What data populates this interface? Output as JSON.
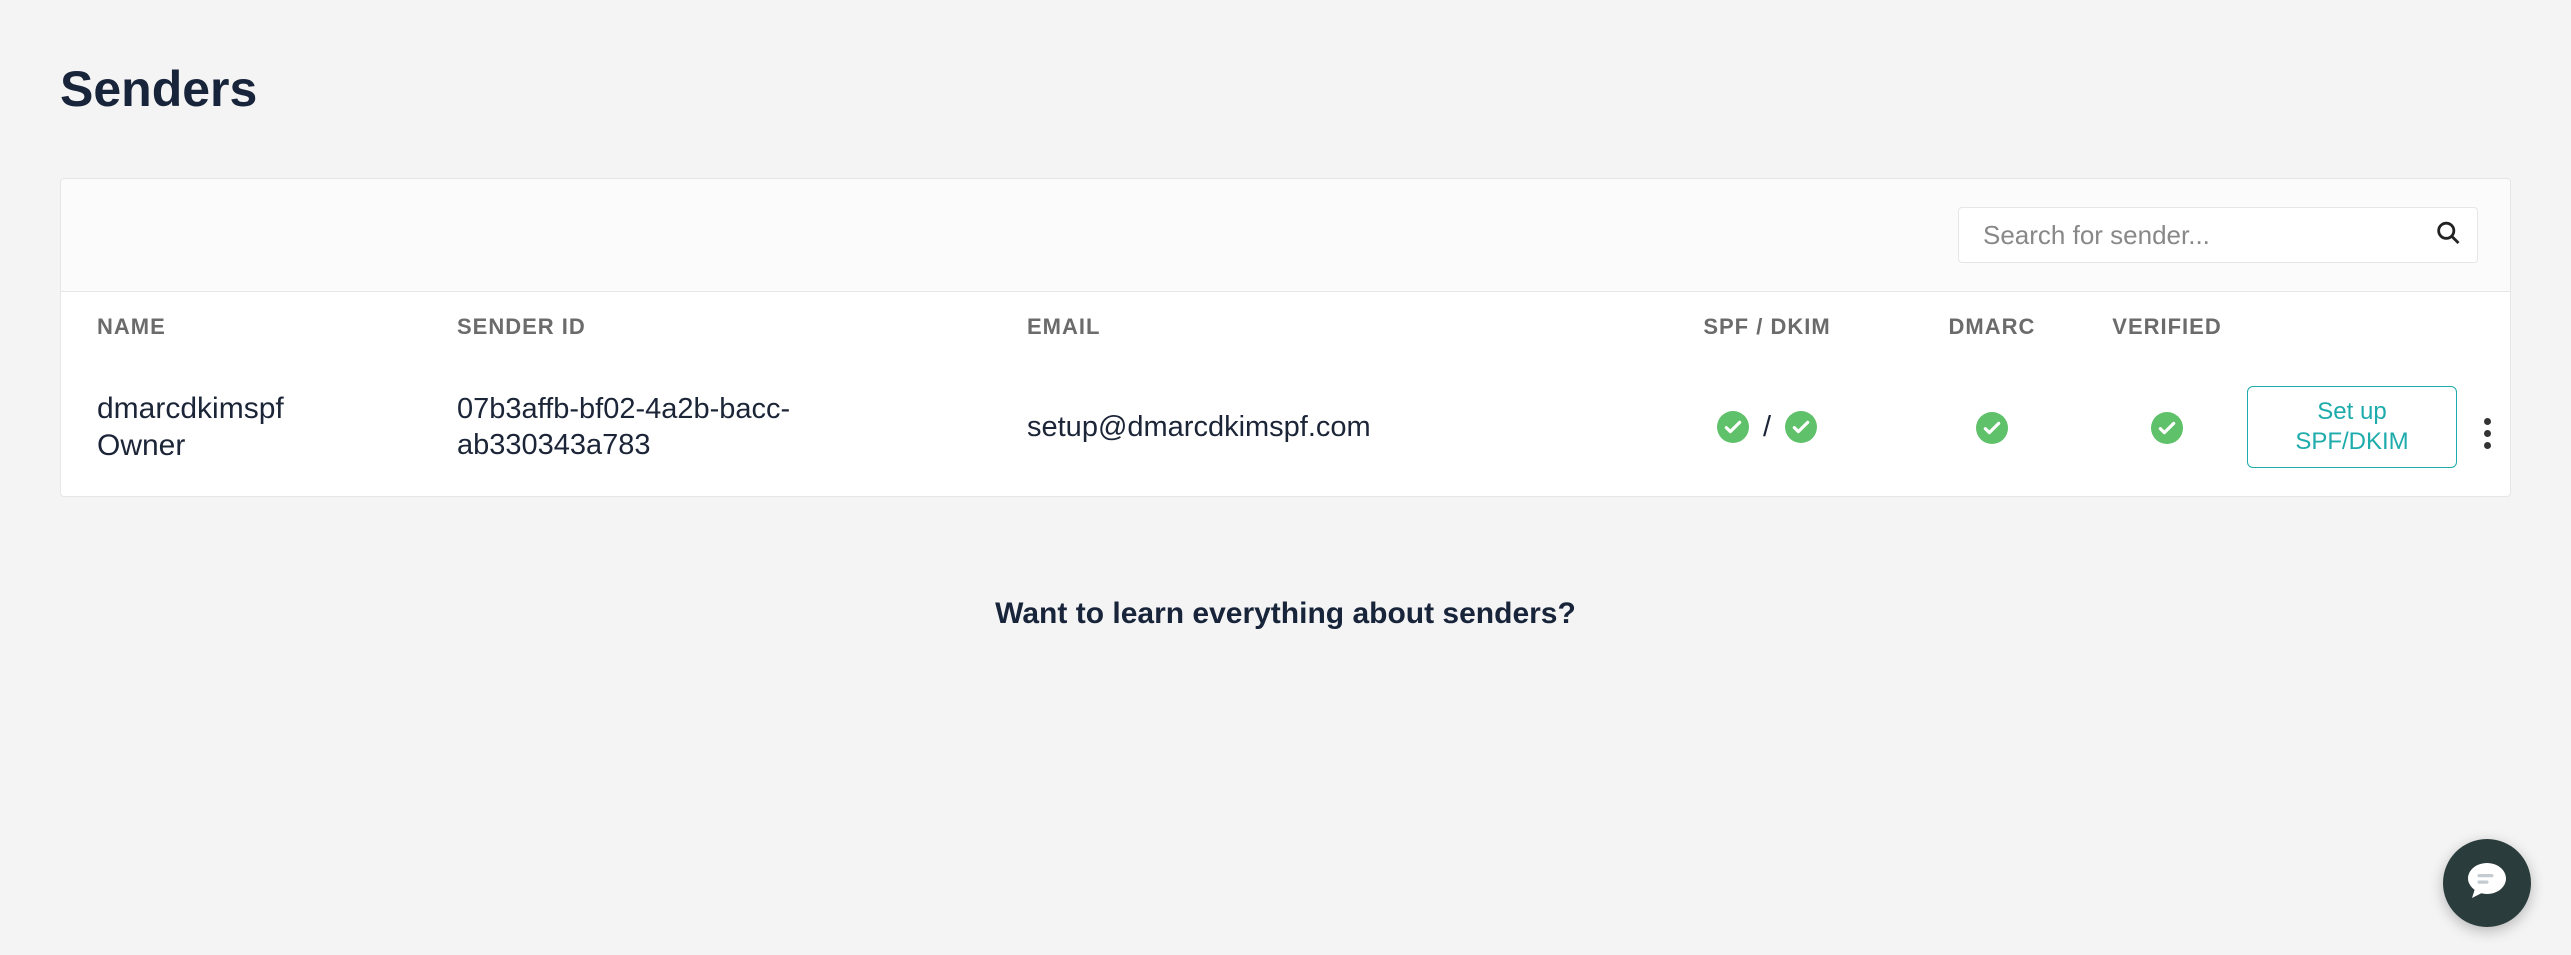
{
  "page": {
    "title": "Senders",
    "learn_cta": "Want to learn everything about senders?"
  },
  "toolbar": {
    "search_placeholder": "Search for sender..."
  },
  "table": {
    "headers": {
      "name": "NAME",
      "sender_id": "SENDER ID",
      "email": "EMAIL",
      "spf_dkim": "SPF / DKIM",
      "dmarc": "DMARC",
      "verified": "VERIFIED"
    },
    "rows": [
      {
        "name_line1": "dmarcdkimspf",
        "name_line2": "Owner",
        "sender_id_line1": "07b3affb-bf02-4a2b-bacc-",
        "sender_id_line2": "ab330343a783",
        "email": "setup@dmarcdkimspf.com",
        "spf_ok": true,
        "dkim_ok": true,
        "dmarc_ok": true,
        "verified_ok": true,
        "action_label": "Set up SPF/DKIM"
      }
    ]
  },
  "colors": {
    "success_badge": "#5fc16a",
    "accent": "#1eabab",
    "chat_fab": "#2b3c3c"
  }
}
